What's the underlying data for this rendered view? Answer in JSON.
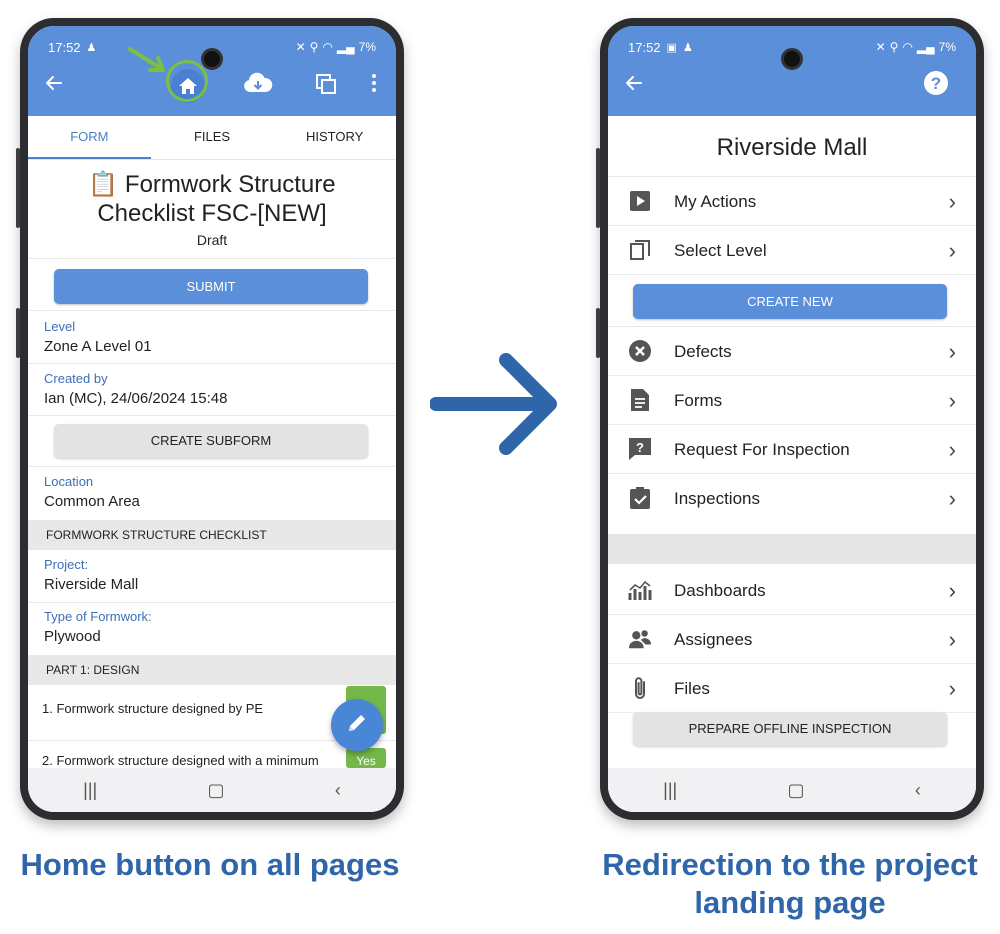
{
  "left_phone": {
    "status": {
      "time": "17:52",
      "battery": "7%"
    },
    "tabs": [
      {
        "label": "FORM",
        "active": true
      },
      {
        "label": "FILES",
        "active": false
      },
      {
        "label": "HISTORY",
        "active": false
      }
    ],
    "form": {
      "title_line1": "📋 Formwork Structure",
      "title_line2": "Checklist FSC-[NEW]",
      "status": "Draft",
      "submit_label": "SUBMIT",
      "create_subform_label": "CREATE SUBFORM",
      "fields": [
        {
          "label": "Level",
          "value": "Zone A Level 01"
        },
        {
          "label": "Created by",
          "value": "Ian (MC), 24/06/2024 15:48"
        },
        {
          "label": "Location",
          "value": "Common Area"
        },
        {
          "label": "Project:",
          "value": "Riverside Mall"
        },
        {
          "label": "Type of Formwork:",
          "value": "Plywood"
        }
      ],
      "sections": [
        "FORMWORK STRUCTURE CHECKLIST",
        "PART 1: DESIGN"
      ],
      "questions": [
        "1. Formwork structure designed by PE",
        "2. Formwork structure designed with a minimum"
      ],
      "answer_chip": "Yes"
    }
  },
  "right_phone": {
    "status": {
      "time": "17:52",
      "battery": "7%"
    },
    "project_title": "Riverside Mall",
    "menu": [
      {
        "label": "My Actions",
        "icon": "play-icon"
      },
      {
        "label": "Select Level",
        "icon": "level-icon"
      },
      {
        "label": "Defects",
        "icon": "close-circle-icon"
      },
      {
        "label": "Forms",
        "icon": "document-icon"
      },
      {
        "label": "Request For Inspection",
        "icon": "question-box-icon"
      },
      {
        "label": "Inspections",
        "icon": "clipboard-check-icon"
      },
      {
        "label": "Dashboards",
        "icon": "chart-icon"
      },
      {
        "label": "Assignees",
        "icon": "people-icon"
      },
      {
        "label": "Files",
        "icon": "paperclip-icon"
      }
    ],
    "create_new_label": "CREATE NEW",
    "prepare_offline_label": "PREPARE OFFLINE INSPECTION"
  },
  "captions": {
    "left": "Home button on all pages",
    "right_line1": "Redirection to the project",
    "right_line2": "landing page"
  },
  "colors": {
    "app_bar": "#5b8fd9",
    "caption": "#2f66aa",
    "highlight": "#7ac143",
    "arrow": "#2f66aa"
  }
}
